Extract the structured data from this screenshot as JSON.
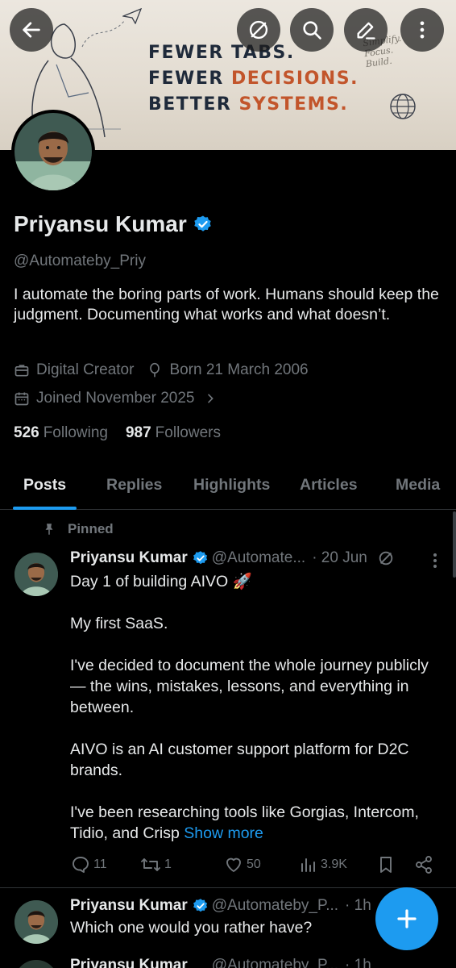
{
  "banner": {
    "line1": "FEWER TABS.",
    "line2_a": "FEWER ",
    "line2_b": "DECISIONS.",
    "line3_a": "BETTER ",
    "line3_b": "SYSTEMS.",
    "note1": "Simplify.",
    "note2": "Focus.",
    "note3": "Build."
  },
  "toolbar": {
    "back_icon": "arrow-left-icon",
    "grok_icon": "slash-circle-icon",
    "search_icon": "search-icon",
    "edit_icon": "pencil-icon",
    "more_icon": "more-vertical-icon"
  },
  "profile": {
    "name": "Priyansu Kumar",
    "handle": "@Automateby_Priy",
    "bio": "I automate the boring parts of work. Humans should keep the judgment.  Documenting what works and what doesn’t.",
    "category": "Digital Creator",
    "born": "Born 21 March 2006",
    "joined": "Joined November 2025",
    "following_count": "526",
    "following_label": "Following",
    "followers_count": "987",
    "followers_label": "Followers"
  },
  "tabs": [
    "Posts",
    "Replies",
    "Highlights",
    "Articles",
    "Media"
  ],
  "pinned_label": "Pinned",
  "post1": {
    "name": "Priyansu Kumar",
    "handle": "@Automate...",
    "time": "· 20 Jun",
    "paragraphs": [
      "Day 1 of building AIVO 🚀",
      "My first SaaS.",
      "I've decided to document the whole journey publicly — the wins, mistakes, lessons, and everything in between.",
      "AIVO is an AI customer support platform for D2C brands."
    ],
    "last_paragraph": "I've been researching tools like Gorgias, Intercom, Tidio, and Crisp ",
    "show_more": "Show more",
    "replies": "11",
    "reposts": "1",
    "likes": "50",
    "views": "3.9K"
  },
  "post2": {
    "name": "Priyansu Kumar",
    "handle": "@Automateby_P...",
    "time": "· 1h",
    "text": "Which one would you rather have?"
  },
  "post3": {
    "name": "Priyansu Kumar",
    "handle": "@Automateby_P...",
    "time": "· 1h"
  },
  "colors": {
    "accent": "#1d9bf0",
    "background": "#000000",
    "text_primary": "#e7e9ea",
    "text_secondary": "#71767b",
    "banner_accent": "#c2552b"
  }
}
